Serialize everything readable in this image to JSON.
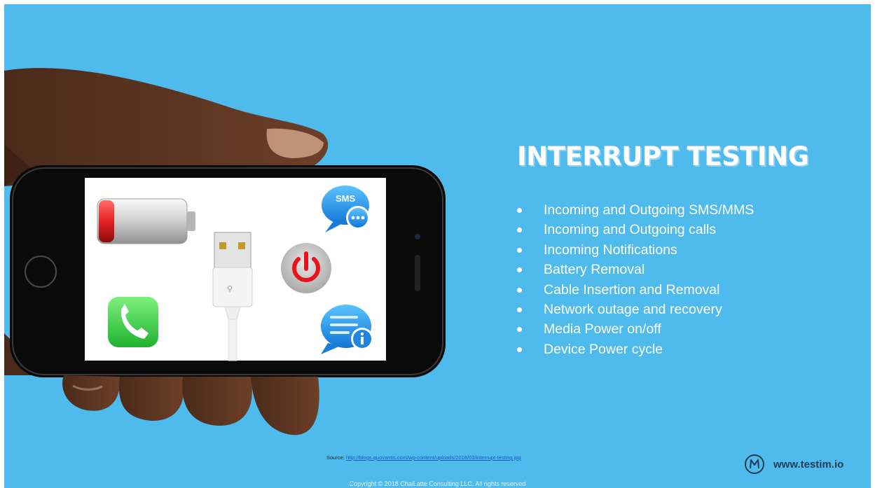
{
  "slide": {
    "title": "INTERRUPT TESTING",
    "bullets": [
      "Incoming and Outgoing SMS/MMS",
      "Incoming and Outgoing calls",
      "Incoming Notifications",
      "Battery Removal",
      "Cable Insertion and Removal",
      "Network outage and recovery",
      "Media Power on/off",
      "Device Power cycle"
    ],
    "source_label": "Source:",
    "source_url": "http://blogs.quovantis.com/wp-content/uploads/2016/03/interrupt-testing.jpg",
    "copyright": "Copyright © 2018 ChaiLatte Consulting LLC. All rights reserved",
    "brand": "www.testim.io"
  },
  "phone_screen": {
    "sms_label": "SMS"
  },
  "colors": {
    "background": "#4fbaec",
    "text": "#ffffff",
    "brand_dark": "#1f3d55",
    "battery_red": "#e52222",
    "call_green": "#4cd964",
    "power_red": "#e8141b"
  }
}
